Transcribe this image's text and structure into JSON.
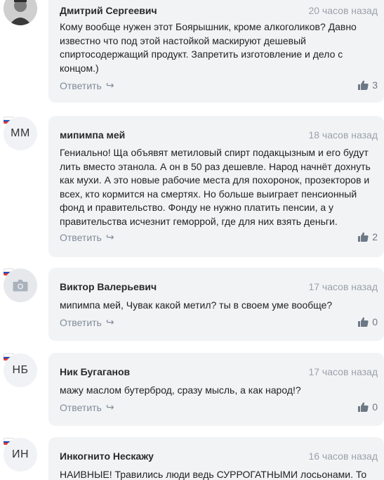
{
  "colors": {
    "card_bg": "#f2f3f5",
    "meta_text": "#9aa2ab",
    "reply_link": "#7f8c99",
    "flag_white": "#ffffff",
    "flag_blue": "#1f47b8",
    "flag_red": "#e53935"
  },
  "comments": [
    {
      "author": "Дмитрий Сергеевич",
      "time": "20 часов назад",
      "avatar_type": "photo",
      "text": "Кому вообще нужен этот Боярышник, кроме алкоголиков? Давно известно что под этой настойкой маскируют дешевый спиртосодержащий продукт. Запретить изготовление и дело с концом.)",
      "reply_label": "Ответить",
      "likes": "3"
    },
    {
      "author": "мипимпа мей",
      "time": "18 часов назад",
      "avatar_type": "initials",
      "initials": "ММ",
      "text": "Гениально! Ща объявят метиловый спирт подакцызным и его будут лить вместо этанола. А он в 50 раз дешевле. Народ начнёт дохнуть как мухи. А это новые рабочие места для похоронок, прозекторов и всех, кто кормится на смертях. Но больше выиграет пенсионный фонд и правительство. Фонду не нужно платить пенсии, а у правительства исчезнит геморрой, где для них взять деньги.",
      "reply_label": "Ответить",
      "likes": "2"
    },
    {
      "author": "Виктор Валерьевич",
      "time": "17 часов назад",
      "avatar_type": "camera",
      "text": "мипимпа мей, Чувак какой метил? ты в своем уме вообще?",
      "reply_label": "Ответить",
      "likes": "0"
    },
    {
      "author": "Ник Бугаганов",
      "time": "17 часов назад",
      "avatar_type": "initials",
      "initials": "НБ",
      "text": "мажу маслом бутерброд, сразу мысль, а как народ!?",
      "reply_label": "Ответить",
      "likes": "0"
    },
    {
      "author": "Инкогнито Нескажу",
      "time": "16 часов назад",
      "avatar_type": "initials",
      "initials": "ИН",
      "text": "НАИВНЫЕ! Травились люди ведь СУРРОГАТНЫМИ лосьонами. То",
      "reply_label": "",
      "likes": ""
    }
  ]
}
